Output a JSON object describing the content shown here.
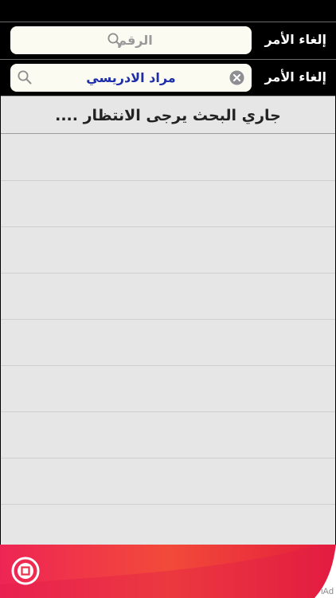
{
  "search_rows": [
    {
      "cancel_label": "إلغاء الأمر",
      "placeholder": "الرقم",
      "value": ""
    },
    {
      "cancel_label": "إلغاء الأمر",
      "placeholder": "",
      "value": "مراد الادريسي"
    }
  ],
  "status": {
    "message": "جاري البحث يرجى الانتظار ...."
  },
  "ad": {
    "label": "iAd",
    "icon": "ad-badge-icon",
    "colors": {
      "primary": "#f43a48",
      "dark": "#c8102e"
    }
  },
  "icons": {
    "search": "search-icon",
    "clear": "clear-icon"
  }
}
